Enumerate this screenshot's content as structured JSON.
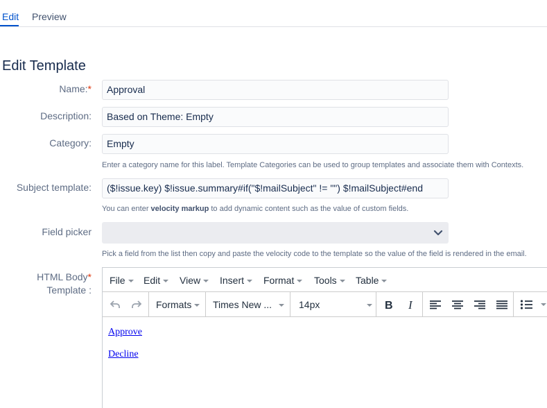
{
  "tabs": [
    {
      "label": "Edit",
      "active": true
    },
    {
      "label": "Preview",
      "active": false
    }
  ],
  "page_title": "Edit Template",
  "fields": {
    "name": {
      "label": "Name:",
      "required": "*",
      "value": "Approval"
    },
    "description": {
      "label": "Description:",
      "value": "Based on Theme: Empty"
    },
    "category": {
      "label": "Category:",
      "value": "Empty",
      "help": "Enter a category name for this label. Template Categories can be used to group templates and associate them with Contexts."
    },
    "subject": {
      "label": "Subject template:",
      "value": "($!issue.key) $!issue.summary#if(\"$!mailSubject\" != \"\") $!mailSubject#end",
      "help_prefix": "You can enter ",
      "help_bold": "velocity markup",
      "help_suffix": " to add dynamic content such as the value of custom fields."
    },
    "field_picker": {
      "label": "Field picker",
      "value": "",
      "help": "Pick a field from the list then copy and paste the velocity code to the template so the value of the field is rendered in the email."
    },
    "html_body": {
      "label_line1": "HTML Body",
      "required": "*",
      "label_line2": "Template :"
    }
  },
  "editor": {
    "menus": [
      "File",
      "Edit",
      "View",
      "Insert",
      "Format",
      "Tools",
      "Table"
    ],
    "toolbar": {
      "formats_label": "Formats",
      "font_family": "Times New ...",
      "font_size": "14px"
    },
    "content_links": [
      "Approve",
      "Decline"
    ]
  },
  "colors": {
    "accent": "#0052cc",
    "required": "#de350b",
    "link": "#0000ee"
  }
}
